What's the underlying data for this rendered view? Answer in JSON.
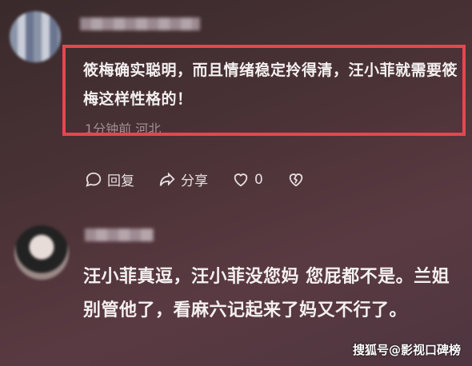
{
  "comments": [
    {
      "text": "筱梅确实聪明，而且情绪稳定拎得清，汪小菲就需要筱梅这样性格的！",
      "meta": "1分钟前 河北",
      "actions": {
        "reply_label": "回复",
        "share_label": "分享",
        "like_count": "0"
      }
    },
    {
      "text": "汪小菲真逗，汪小菲没您妈 您屁都不是。兰姐别管他了，看麻六记起来了妈又不行了。"
    }
  ],
  "watermark": "搜狐号@影视口碑榜",
  "colors": {
    "highlight_border": "#e64650"
  },
  "icons": [
    "reply-icon",
    "share-icon",
    "heart-icon",
    "broken-heart-icon"
  ]
}
